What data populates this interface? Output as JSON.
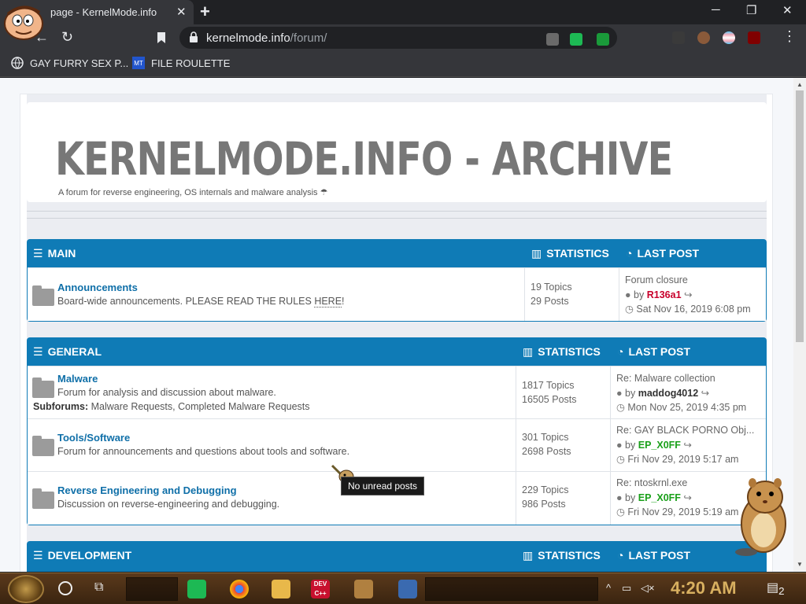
{
  "browser": {
    "tab_title": "page - KernelMode.info",
    "tab_close": "✕",
    "new_tab": "+",
    "win_minimize": "─",
    "win_maximize": "❐",
    "win_close": "✕",
    "url_host": "kernelmode.info",
    "url_path": "/forum/",
    "bookmarks": [
      {
        "label": "GAY FURRY SEX P..."
      },
      {
        "label": "FILE ROULETTE",
        "icon_text": "MT"
      }
    ],
    "icons": {
      "back": "←",
      "reload": "↻",
      "bookmark": "🔖",
      "lock": "🔒",
      "menu": "⋮"
    }
  },
  "site": {
    "title": "KERNELMODE.INFO - ARCHIVE",
    "description": "A forum for reverse engineering, OS internals and malware analysis",
    "description_icon": "☂"
  },
  "categories": [
    {
      "title": "MAIN",
      "stats_label": "STATISTICS",
      "last_label": "LAST POST",
      "forums": [
        {
          "title": "Announcements",
          "description_prefix": "Board-wide announcements. PLEASE READ THE RULES ",
          "description_link": "HERE",
          "description_suffix": "!",
          "topics": "19 Topics",
          "posts": "29 Posts",
          "last_title": "Forum closure",
          "last_by": "by",
          "last_user": "R136a1",
          "last_user_color": "red",
          "last_date": "Sat Nov 16, 2019 6:08 pm"
        }
      ]
    },
    {
      "title": "GENERAL",
      "stats_label": "STATISTICS",
      "last_label": "LAST POST",
      "forums": [
        {
          "title": "Malware",
          "description": "Forum for analysis and discussion about malware.",
          "subforums_label": "Subforums:",
          "subforums": "Malware Requests, Completed Malware Requests",
          "topics": "1817 Topics",
          "posts": "16505 Posts",
          "last_title": "Re: Malware collection",
          "last_by": "by",
          "last_user": "maddog4012",
          "last_user_color": "dark",
          "last_date": "Mon Nov 25, 2019 4:35 pm"
        },
        {
          "title": "Tools/Software",
          "description": "Forum for announcements and questions about tools and software.",
          "topics": "301 Topics",
          "posts": "2698 Posts",
          "last_title": "Re: GAY BLACK PORNO Obj...",
          "last_by": "by",
          "last_user": "EP_X0FF",
          "last_user_color": "green",
          "last_date": "Fri Nov 29, 2019 5:17 am"
        },
        {
          "title": "Reverse Engineering and Debugging",
          "description": "Discussion on reverse-engineering and debugging.",
          "topics": "229 Topics",
          "posts": "986 Posts",
          "last_title": "Re: ntoskrnl.exe",
          "last_by": "by",
          "last_user": "EP_X0FF",
          "last_user_color": "green",
          "last_date": "Fri Nov 29, 2019 5:19 am"
        }
      ]
    },
    {
      "title": "DEVELOPMENT",
      "stats_label": "STATISTICS",
      "last_label": "LAST POST",
      "forums": []
    }
  ],
  "tooltip": "No unread posts",
  "taskbar": {
    "clock": "4:20 AM",
    "notification_count": "2",
    "app_dev_label": "DEV C++"
  },
  "colors": {
    "cat_header": "#0f7bb6",
    "forum_link": "#0f6fa8",
    "user_red": "#c8002b",
    "user_green": "#1aa01a",
    "clock": "#d8b060"
  }
}
